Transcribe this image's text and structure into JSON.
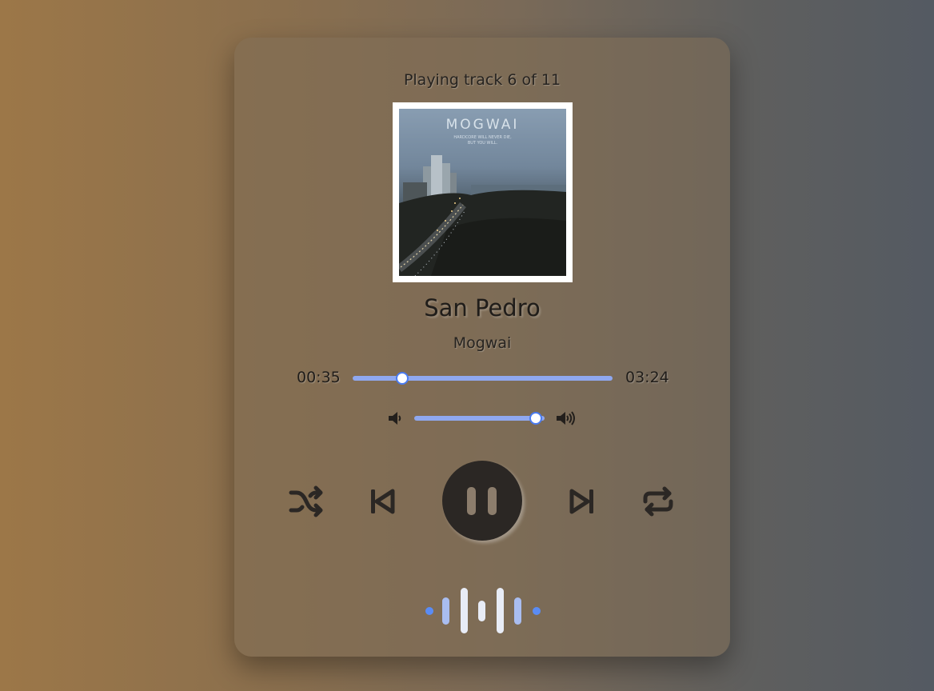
{
  "player": {
    "status": "Playing track 6 of 11",
    "album_cover": {
      "band": "MOGWAI",
      "subtitle_line1": "HARDCORE WILL NEVER DIE,",
      "subtitle_line2": "BUT YOU WILL."
    },
    "track_title": "San Pedro",
    "artist": "Mogwai",
    "elapsed": "00:35",
    "duration": "03:24",
    "progress_fraction": 0.19,
    "volume_fraction": 0.93,
    "is_playing": true
  },
  "controls": {
    "shuffle_icon": "shuffle-icon",
    "previous_icon": "skip-previous-icon",
    "play_pause_icon": "pause-icon",
    "next_icon": "skip-next-icon",
    "repeat_icon": "repeat-icon",
    "volume_low_icon": "volume-low-icon",
    "volume_high_icon": "volume-high-icon"
  },
  "colors": {
    "accent": "#8fa8f0",
    "thumb_border": "#4a7bf0",
    "icon": "#2b2724",
    "visualizer_light": "#e8ecf6",
    "visualizer_mid": "#a9bdf0",
    "visualizer_dot": "#5a8cf5"
  }
}
